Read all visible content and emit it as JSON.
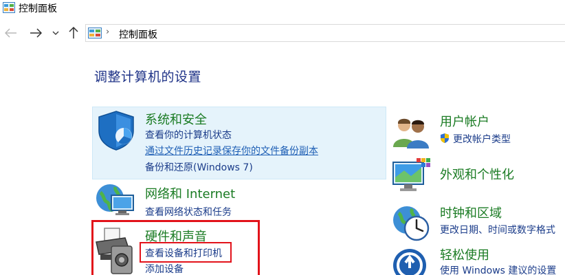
{
  "window": {
    "title": "控制面板"
  },
  "address_bar": {
    "path": "控制面板",
    "separator": "›"
  },
  "nav": {
    "back": "←",
    "forward": "→",
    "recent": "˅",
    "up": "↑"
  },
  "page": {
    "heading": "调整计算机的设置"
  },
  "categories": {
    "system_security": {
      "title": "系统和安全",
      "links": [
        "查看你的计算机状态",
        "通过文件历史记录保存你的文件备份副本",
        "备份和还原(Windows 7)"
      ]
    },
    "network": {
      "title": "网络和 Internet",
      "links": [
        "查看网络状态和任务"
      ]
    },
    "hardware": {
      "title": "硬件和声音",
      "links": [
        "查看设备和打印机",
        "添加设备"
      ]
    },
    "user_accounts": {
      "title": "用户帐户",
      "links": [
        "更改帐户类型"
      ]
    },
    "appearance": {
      "title": "外观和个性化"
    },
    "clock_region": {
      "title": "时钟和区域",
      "links": [
        "更改日期、时间或数字格式"
      ]
    },
    "ease_access": {
      "title": "轻松使用",
      "links": [
        "使用 Windows 建议的设置"
      ]
    }
  },
  "colors": {
    "category_title": "#1a7b23",
    "link": "#1b3c8a",
    "heading": "#1e3287",
    "highlight": "#e5f3fb",
    "annotation_red": "#e2121a"
  }
}
